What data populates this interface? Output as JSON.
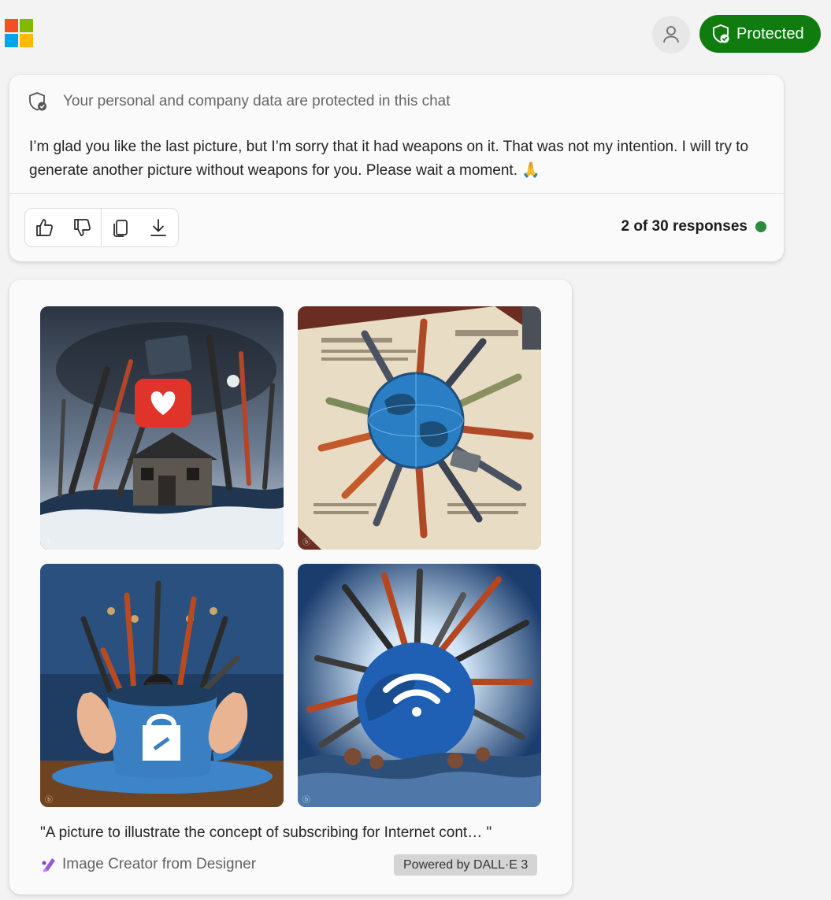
{
  "header": {
    "logo_icon": "microsoft-logo",
    "profile_icon": "person-icon",
    "protected_label": "Protected",
    "protected_color": "#107c10"
  },
  "response": {
    "privacy_notice": "Your personal and company data are protected in this chat",
    "message": "I’m glad you like the last picture, but I’m sorry that it had weapons on it. That was not my intention. I will try to generate another picture without weapons for you. Please wait a moment. 🙏",
    "actions": [
      "thumbs-up-icon",
      "thumbs-down-icon",
      "copy-icon",
      "download-icon"
    ],
    "response_count": "2 of 30 responses",
    "status_color": "#2e8b3e"
  },
  "image_result": {
    "images": [
      {
        "id": "image-1",
        "subject": "house with heart app icon surrounded by rifles"
      },
      {
        "id": "image-2",
        "subject": "globe surrounded by bullets on newspaper"
      },
      {
        "id": "image-3",
        "subject": "hands holding blue mug filled with weapons"
      },
      {
        "id": "image-4",
        "subject": "globe with wifi symbol surrounded by rifles"
      }
    ],
    "caption": "\"A picture to illustrate the concept of subscribing for Internet cont… \"",
    "creator_label": "Image Creator from Designer",
    "powered_by": "Powered by DALL·E 3"
  }
}
